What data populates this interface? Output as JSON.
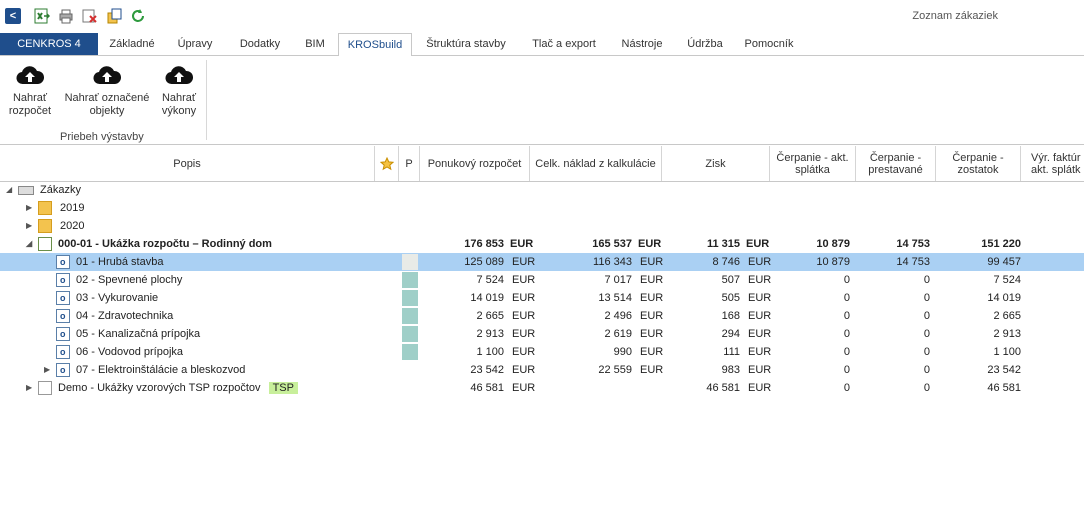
{
  "window": {
    "title": "Zoznam zákaziek"
  },
  "tabs": [
    "CENKROS 4",
    "Základné",
    "Úpravy",
    "Dodatky",
    "BIM",
    "KROSbuild",
    "Štruktúra stavby",
    "Tlač a export",
    "Nástroje",
    "Údržba",
    "Pomocník"
  ],
  "ribbon": {
    "buttons": [
      {
        "label": "Nahrať rozpočet",
        "icon": "cloud-upload-icon"
      },
      {
        "label": "Nahrať označené objekty",
        "icon": "cloud-upload-icon"
      },
      {
        "label": "Nahrať výkony",
        "icon": "cloud-upload-icon"
      }
    ],
    "group_label": "Priebeh výstavby"
  },
  "columns": {
    "popis": "Popis",
    "p": "P",
    "ponukovy": "Ponukový rozpočet",
    "naklad": "Celk. náklad z kalkulácie",
    "zisk": "Zisk",
    "cerp_akt": "Čerpanie - akt. splátka",
    "cerp_prest": "Čerpanie - prestavané",
    "cerp_zost": "Čerpanie - zostatok",
    "vyr_fakt": "Výr. faktúr akt. splátk"
  },
  "tree": {
    "root": "Zákazky",
    "y2019": "2019",
    "y2020": "2020",
    "project": {
      "name": "000-01 - Ukážka rozpočtu – Rodinný dom",
      "ponukovy": "176 853",
      "naklad": "165 537",
      "zisk": "11 315",
      "cerp_akt": "10 879",
      "cerp_prest": "14 753",
      "cerp_zost": "151 220"
    },
    "currency": "EUR",
    "items": [
      {
        "name": "01 - Hrubá stavba",
        "ponukovy": "125 089",
        "naklad": "116 343",
        "zisk": "8 746",
        "cerp_akt": "10 879",
        "cerp_prest": "14 753",
        "cerp_zost": "99 457"
      },
      {
        "name": "02 - Spevnené plochy",
        "ponukovy": "7 524",
        "naklad": "7 017",
        "zisk": "507",
        "cerp_akt": "0",
        "cerp_prest": "0",
        "cerp_zost": "7 524"
      },
      {
        "name": "03 - Vykurovanie",
        "ponukovy": "14 019",
        "naklad": "13 514",
        "zisk": "505",
        "cerp_akt": "0",
        "cerp_prest": "0",
        "cerp_zost": "14 019"
      },
      {
        "name": "04 - Zdravotechnika",
        "ponukovy": "2 665",
        "naklad": "2 496",
        "zisk": "168",
        "cerp_akt": "0",
        "cerp_prest": "0",
        "cerp_zost": "2 665"
      },
      {
        "name": "05 - Kanalizačná prípojka",
        "ponukovy": "2 913",
        "naklad": "2 619",
        "zisk": "294",
        "cerp_akt": "0",
        "cerp_prest": "0",
        "cerp_zost": "2 913"
      },
      {
        "name": "06 - Vodovod prípojka",
        "ponukovy": "1 100",
        "naklad": "990",
        "zisk": "111",
        "cerp_akt": "0",
        "cerp_prest": "0",
        "cerp_zost": "1 100"
      },
      {
        "name": "07 - Elektroinštálácie a bleskozvod",
        "ponukovy": "23 542",
        "naklad": "22 559",
        "zisk": "983",
        "cerp_akt": "0",
        "cerp_prest": "0",
        "cerp_zost": "23 542"
      }
    ],
    "demo": {
      "name": "Demo - Ukážky vzorových TSP rozpočtov",
      "badge": "TSP",
      "ponukovy": "46 581",
      "zisk": "46 581",
      "cerp_akt": "0",
      "cerp_prest": "0",
      "cerp_zost": "46 581"
    }
  }
}
